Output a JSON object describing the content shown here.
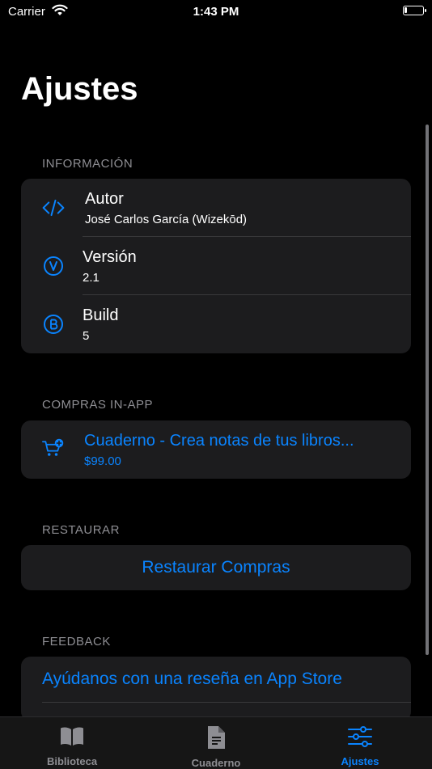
{
  "status_bar": {
    "carrier": "Carrier",
    "time": "1:43 PM"
  },
  "page_title": "Ajustes",
  "sections": {
    "info": {
      "header": "INFORMACIÓN",
      "rows": [
        {
          "title": "Autor",
          "subtitle": "José Carlos García (Wizekōd)",
          "icon": "code-icon"
        },
        {
          "title": "Versión",
          "subtitle": "2.1",
          "icon": "v-circle-icon"
        },
        {
          "title": "Build",
          "subtitle": "5",
          "icon": "b-circle-icon"
        }
      ]
    },
    "purchases": {
      "header": "COMPRAS IN-APP",
      "item": {
        "title": "Cuaderno - Crea notas de tus libros...",
        "price": "$99.00",
        "icon": "cart-plus-icon"
      }
    },
    "restore": {
      "header": "RESTAURAR",
      "button": "Restaurar Compras"
    },
    "feedback": {
      "header": "FEEDBACK",
      "link": "Ayúdanos con una reseña en App Store"
    }
  },
  "tabs": [
    {
      "label": "Biblioteca",
      "icon": "book-icon",
      "active": false
    },
    {
      "label": "Cuaderno",
      "icon": "document-icon",
      "active": false
    },
    {
      "label": "Ajustes",
      "icon": "sliders-icon",
      "active": true
    }
  ],
  "colors": {
    "accent": "#0a84ff",
    "background": "#000000",
    "card": "#1c1c1e",
    "muted": "#8e8e93"
  }
}
